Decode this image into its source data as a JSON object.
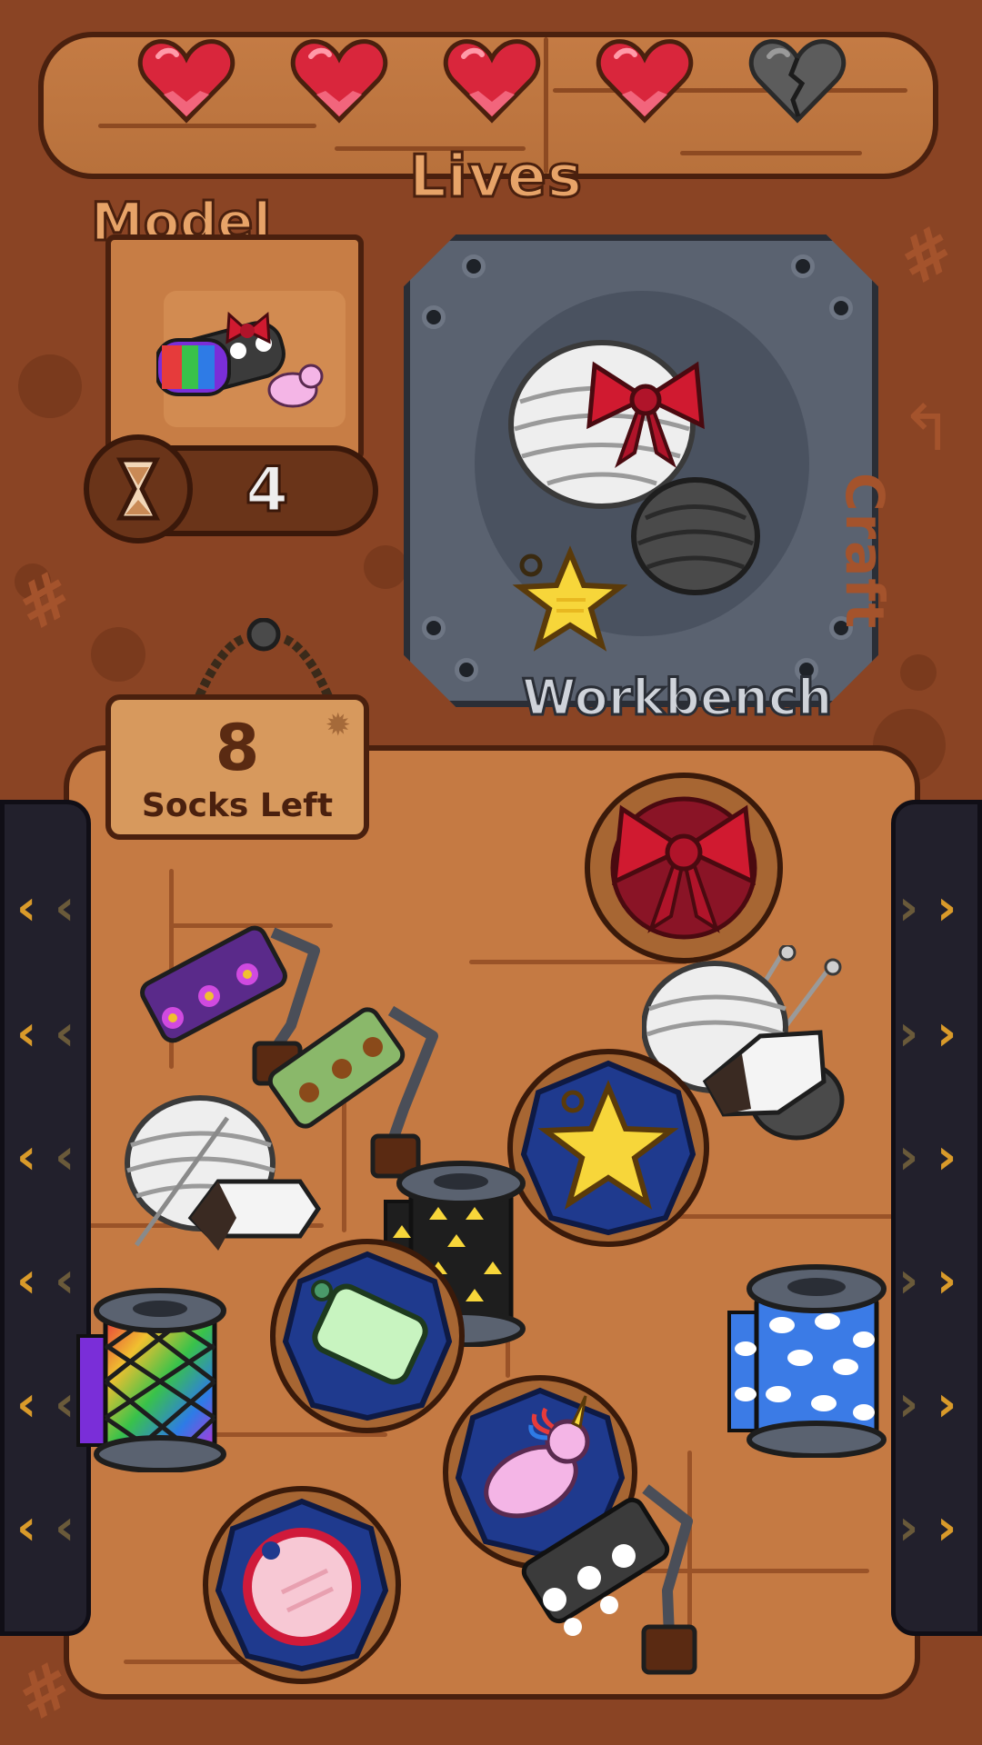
{
  "lives": {
    "label": "Lives",
    "total": 5,
    "remaining": 4,
    "hearts": [
      "full",
      "full",
      "full",
      "full",
      "broken"
    ]
  },
  "model": {
    "label": "Model",
    "items": [
      "rainbow-sock",
      "skull-sock",
      "red-bow",
      "unicorn-patch"
    ]
  },
  "timer": {
    "value": "4",
    "icon": "hourglass-icon"
  },
  "workbench": {
    "label": "Workbench",
    "items": [
      "white-yarn-ball",
      "red-bow",
      "gray-yarn-ball",
      "yellow-star-tag"
    ]
  },
  "craft_hint": {
    "label": "Craft"
  },
  "socks_sign": {
    "count": "8",
    "label": "Socks Left"
  },
  "board_items": [
    "red-bow-token",
    "purple-flower-paint-roller",
    "brown-bear-paint-roller",
    "white-yarn-with-knitting-needles",
    "yellow-star-tag-token",
    "black-arrow-fabric-spool",
    "green-tag-token",
    "rainbow-fabric-spool",
    "blue-cloud-fabric-spool",
    "unicorn-patch-token",
    "skull-paint-roller",
    "pink-button-token"
  ],
  "colors": {
    "background": "#8a4424",
    "wood": "#c57a43",
    "outline": "#4a200e",
    "workbench": "#5a6270",
    "heart": "#d9263c",
    "heart_broken": "#5c5c5c",
    "chevron": "#d99a2a"
  }
}
